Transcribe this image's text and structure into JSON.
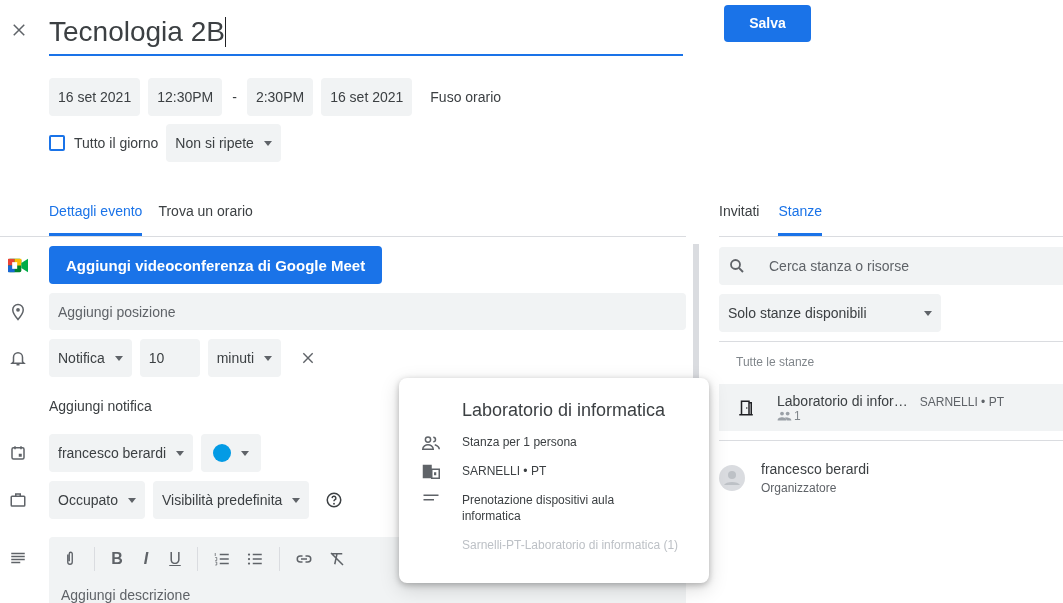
{
  "title": "Tecnologia 2B",
  "save_button": "Salva",
  "datetime": {
    "start_date": "16 set 2021",
    "start_time": "12:30PM",
    "separator": "-",
    "end_time": "2:30PM",
    "end_date": "16 set 2021",
    "timezone": "Fuso orario"
  },
  "all_day": {
    "label": "Tutto il giorno",
    "checked": false
  },
  "repeat": "Non si ripete",
  "tabs": [
    {
      "label": "Dettagli evento",
      "selected": true
    },
    {
      "label": "Trova un orario",
      "selected": false
    }
  ],
  "meet_button": "Aggiungi videoconferenza di Google Meet",
  "location": {
    "placeholder": "Aggiungi posizione"
  },
  "notification": {
    "type": "Notifica",
    "value": "10",
    "unit": "minuti"
  },
  "add_notification": "Aggiungi notifica",
  "calendar": {
    "name": "francesco berardi",
    "color": "#039be5"
  },
  "availability": "Occupato",
  "visibility": "Visibilità predefinita",
  "format_toolbar": [
    {
      "kind": "attach"
    },
    {
      "kind": "bold",
      "glyph": "B"
    },
    {
      "kind": "italic",
      "glyph": "I"
    },
    {
      "kind": "underline",
      "glyph": "U"
    },
    {
      "kind": "numbered"
    },
    {
      "kind": "bulleted"
    },
    {
      "kind": "link"
    },
    {
      "kind": "clear"
    }
  ],
  "description": {
    "placeholder": "Aggiungi descrizione"
  },
  "side_tabs": [
    {
      "label": "Invitati",
      "selected": false
    },
    {
      "label": "Stanze",
      "selected": true
    }
  ],
  "room_search": {
    "placeholder": "Cerca stanza o risorse"
  },
  "room_filter": "Solo stanze disponibili",
  "rooms_heading": "Tutte le stanze",
  "rooms": [
    {
      "name": "Laboratorio di infor…",
      "location": "SARNELLI • PT",
      "capacity": "1",
      "selected": true
    }
  ],
  "guests": [
    {
      "name": "francesco berardi",
      "role": "Organizzatore"
    }
  ],
  "room_popup": {
    "title": "Laboratorio di informatica",
    "details": [
      {
        "kind": "capacity",
        "text": "Stanza per 1 persona"
      },
      {
        "kind": "building",
        "text": "SARNELLI • PT"
      },
      {
        "kind": "description",
        "text": "Prenotazione dispositivi aula informatica"
      }
    ],
    "footnote": "Sarnelli-PT-Laboratorio di informatica (1)"
  }
}
